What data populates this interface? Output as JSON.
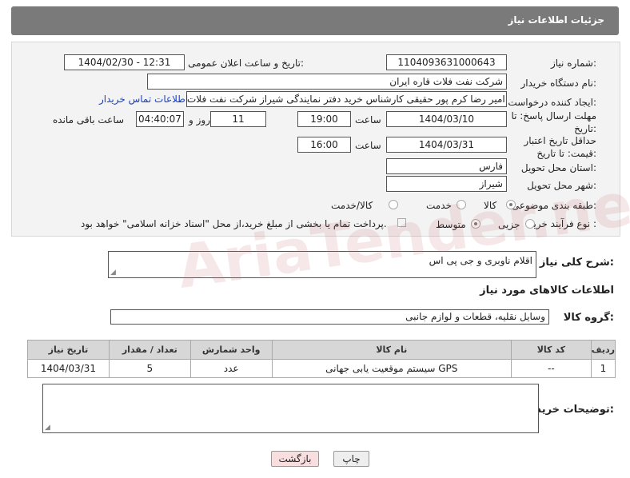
{
  "header": {
    "title": "جزئیات اطلاعات نیاز"
  },
  "form": {
    "need_number_label": "شماره نیاز:",
    "need_number": "1104093631000643",
    "announce_label": "تاریخ و ساعت اعلان عمومی:",
    "announce_value": "1404/02/30 - 12:31",
    "buyer_org_label": "نام دستگاه خریدار:",
    "buyer_org": "شرکت نفت فلات قاره ایران",
    "creator_label": "ایجاد کننده درخواست:",
    "creator": "امیر رضا کرم پور حقیقی کارشناس خرید دفتر نمایندگی شیراز شرکت نفت فلات",
    "contact_link": "اطلاعات تماس خریدار",
    "deadline_label": "مهلت ارسال پاسخ: تا تاریخ:",
    "deadline_date": "1404/03/10",
    "time_label": "ساعت",
    "deadline_time": "19:00",
    "days": "11",
    "days_label": "روز و",
    "remaining": "04:40:07",
    "remaining_label": "ساعت باقی مانده",
    "price_valid_label": "حداقل تاریخ اعتبار قیمت: تا تاریخ:",
    "price_valid_date": "1404/03/31",
    "price_valid_time": "16:00",
    "province_label": "استان محل تحویل:",
    "province": "فارس",
    "city_label": "شهر محل تحویل:",
    "city": "شیراز",
    "category_label": "طبقه بندی موضوعی:",
    "category_options": [
      "کالا",
      "خدمت",
      "کالا/خدمت"
    ],
    "process_label": "نوع فرآیند خرید :",
    "process_options": [
      "جزیی",
      "متوسط"
    ],
    "payment_note": "پرداخت تمام یا بخشی از مبلغ خرید،از محل \"اسناد خزانه اسلامی\" خواهد بود."
  },
  "description": {
    "label": "شرح کلی نیاز:",
    "value": "اقلام ناوبری و جی پی اس"
  },
  "goods": {
    "section_title": "اطلاعات کالاهای مورد نیاز",
    "group_label": "گروه کالا:",
    "group_value": "وسایل نقلیه، قطعات و لوازم جانبی",
    "columns": [
      "ردیف",
      "کد کالا",
      "نام کالا",
      "واحد شمارش",
      "تعداد / مقدار",
      "تاریخ نیاز"
    ],
    "rows": [
      {
        "row": "1",
        "code": "--",
        "name": "سیستم موقعیت یابی جهانی GPS",
        "unit": "عدد",
        "qty": "5",
        "date": "1404/03/31"
      }
    ]
  },
  "notes": {
    "label": "توضیحات خریدار:"
  },
  "buttons": {
    "print": "چاپ",
    "back": "بازگشت"
  },
  "watermark": "AriaTender.net",
  "colors": {
    "header_bg": "#7a7a7a",
    "link": "#1a3fbf",
    "back_button_bg": "#f8dede"
  }
}
